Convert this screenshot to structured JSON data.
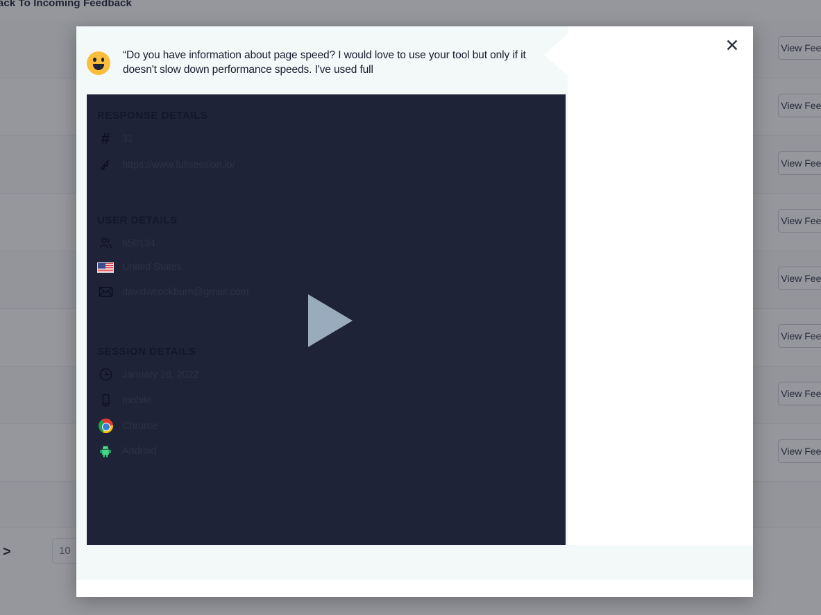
{
  "background": {
    "title": "Back To Incoming Feedback",
    "row_action_label": "View Feedback",
    "rows_count": 8,
    "pagination": {
      "next_label": ">",
      "per_page_value": "10",
      "per_page_caret": "▾"
    }
  },
  "modal": {
    "close_label": "✕",
    "quote": {
      "emoji": "smiley-face-emoji",
      "text": "“Do you have information about page speed? I would love to use your tool but only if it doesn't slow down performance speeds. I've used full"
    },
    "video": {
      "play_label": "play-button",
      "background_color": "#1e2338",
      "play_color": "#9aabbe"
    },
    "sections": [
      {
        "id": "response",
        "title": "RESPONSE DETAILS",
        "rows": [
          {
            "icon": "hash-icon",
            "value": "31"
          },
          {
            "icon": "cursor-arrow-icon",
            "value": "https://www.fullsession.io/"
          }
        ]
      },
      {
        "id": "user",
        "title": "USER DETAILS",
        "rows": [
          {
            "icon": "users-icon",
            "value": "650134"
          },
          {
            "icon": "us-flag-icon",
            "value": "United States"
          },
          {
            "icon": "envelope-icon",
            "value": "davidwcockburn@gmail.com"
          }
        ]
      },
      {
        "id": "session",
        "title": "SESSION DETAILS",
        "rows": [
          {
            "icon": "clock-icon",
            "value": "January 28, 2022"
          },
          {
            "icon": "mobile-phone-icon",
            "value": "mobile"
          },
          {
            "icon": "chrome-icon",
            "value": "Chrome"
          },
          {
            "icon": "android-icon",
            "value": "Android"
          }
        ]
      }
    ]
  },
  "colors": {
    "modal_accent": "#f3f9f9",
    "video_bg": "#1e2338",
    "text_dark": "#11182a"
  }
}
